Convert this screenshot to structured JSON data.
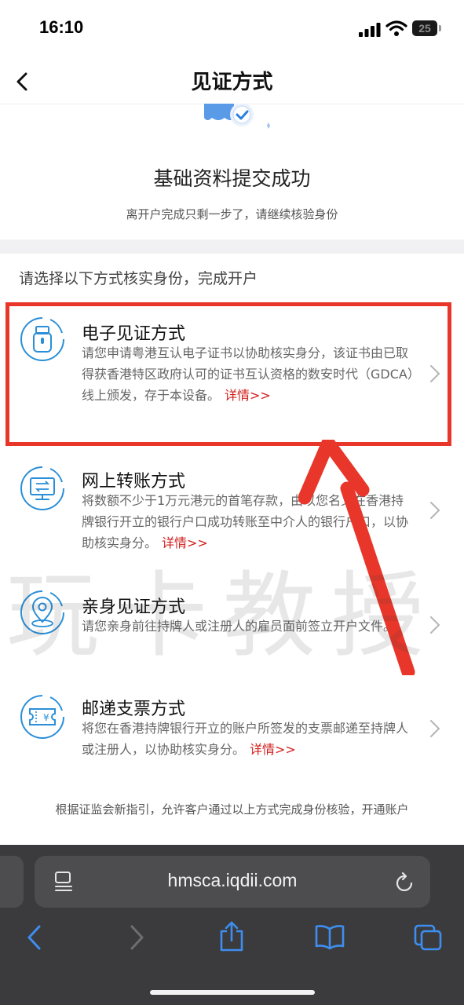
{
  "status_bar": {
    "time": "16:10",
    "battery": "25"
  },
  "nav": {
    "title": "见证方式"
  },
  "hero": {
    "title": "基础资料提交成功",
    "subtitle": "离开户完成只剩一步了，请继续核验身份"
  },
  "prompt": "请选择以下方式核实身份，完成开户",
  "options": [
    {
      "title": "电子见证方式",
      "desc": "请您申请粤港互认电子证书以协助核实身分，该证书由已取得获香港特区政府认可的证书互认资格的数安时代（GDCA）线上颁发，存于本设备。",
      "link": "详情>>",
      "icon": "usb-key-icon"
    },
    {
      "title": "网上转账方式",
      "desc": "将数额不少于1万元港元的首笔存款，由以您名义在香港持牌银行开立的银行户口成功转账至中介人的银行户口，以协助核实身分。",
      "link": "详情>>",
      "icon": "monitor-transfer-icon"
    },
    {
      "title": "亲身见证方式",
      "desc": "请您亲身前往持牌人或注册人的雇员面前签立开户文件。",
      "link": "",
      "icon": "location-pin-icon"
    },
    {
      "title": "邮递支票方式",
      "desc": "将您在香港持牌银行开立的账户所签发的支票邮递至持牌人或注册人，以协助核实身分。",
      "link": "详情>>",
      "icon": "cheque-icon"
    }
  ],
  "watermark": "玩卡教授",
  "footer_note": "根据证监会新指引，允许客户通过以上方式完成身份核验，开通账户",
  "browser": {
    "url": "hmsca.iqdii.com"
  },
  "colors": {
    "accent": "#2b8fd8",
    "link": "#d0201e",
    "highlight": "#e8372a",
    "toolbar_blue": "#3d8ef0"
  }
}
